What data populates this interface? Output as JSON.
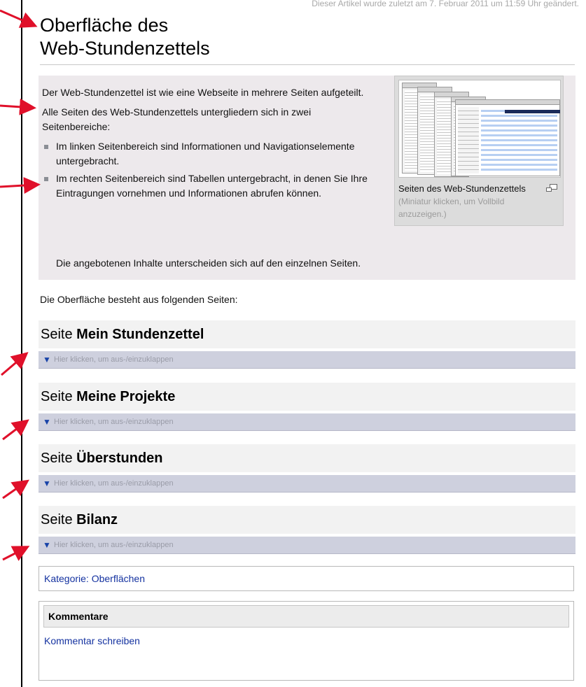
{
  "article": {
    "last_modified": "Dieser Artikel wurde zuletzt am 7. Februar 2011 um 11:59 Uhr geändert.",
    "title_line1": "Oberfläche des",
    "title_line2": "Web-Stundenzettels"
  },
  "intro": {
    "para1": "Der Web-Stundenzettel ist wie eine Webseite in mehrere Seiten aufgeteilt.",
    "para2": "Alle Seiten des Web-Stundenzettels untergliedern sich in zwei Seitenbereiche:",
    "bullets": [
      "Im linken Seitenbereich sind Informationen und Navigationselemente untergebracht.",
      "Im rechten Seitenbereich sind Tabellen untergebracht, in denen Sie Ihre Eintragungen vornehmen und Informationen abrufen können."
    ],
    "footer": "Die angebotenen Inhalte unterscheiden sich auf den einzelnen Seiten."
  },
  "thumbnail": {
    "caption": "Seiten des Web-Stundenzettels",
    "hint": "(Miniatur klicken, um Vollbild anzuzeigen.)",
    "icon": "enlarge-icon"
  },
  "pages_intro": "Die Oberfläche besteht aus folgenden Seiten:",
  "sections": [
    {
      "prefix": "Seite ",
      "name": "Mein Stundenzettel",
      "toggle": "Hier klicken, um aus-/einzuklappen"
    },
    {
      "prefix": "Seite ",
      "name": "Meine Projekte",
      "toggle": "Hier klicken, um aus-/einzuklappen"
    },
    {
      "prefix": "Seite ",
      "name": "Überstunden",
      "toggle": "Hier klicken, um aus-/einzuklappen"
    },
    {
      "prefix": "Seite ",
      "name": "Bilanz",
      "toggle": "Hier klicken, um aus-/einzuklappen"
    }
  ],
  "toggle_icon": "triangle-down-icon",
  "category": {
    "label": "Kategorie: Oberflächen"
  },
  "comments": {
    "heading": "Kommentare",
    "link": "Kommentar schreiben"
  },
  "colors": {
    "annotation_arrow": "#e0102a",
    "link": "#1432a0",
    "intro_background": "#ede9ec",
    "toggle_bar": "#ced0de"
  }
}
